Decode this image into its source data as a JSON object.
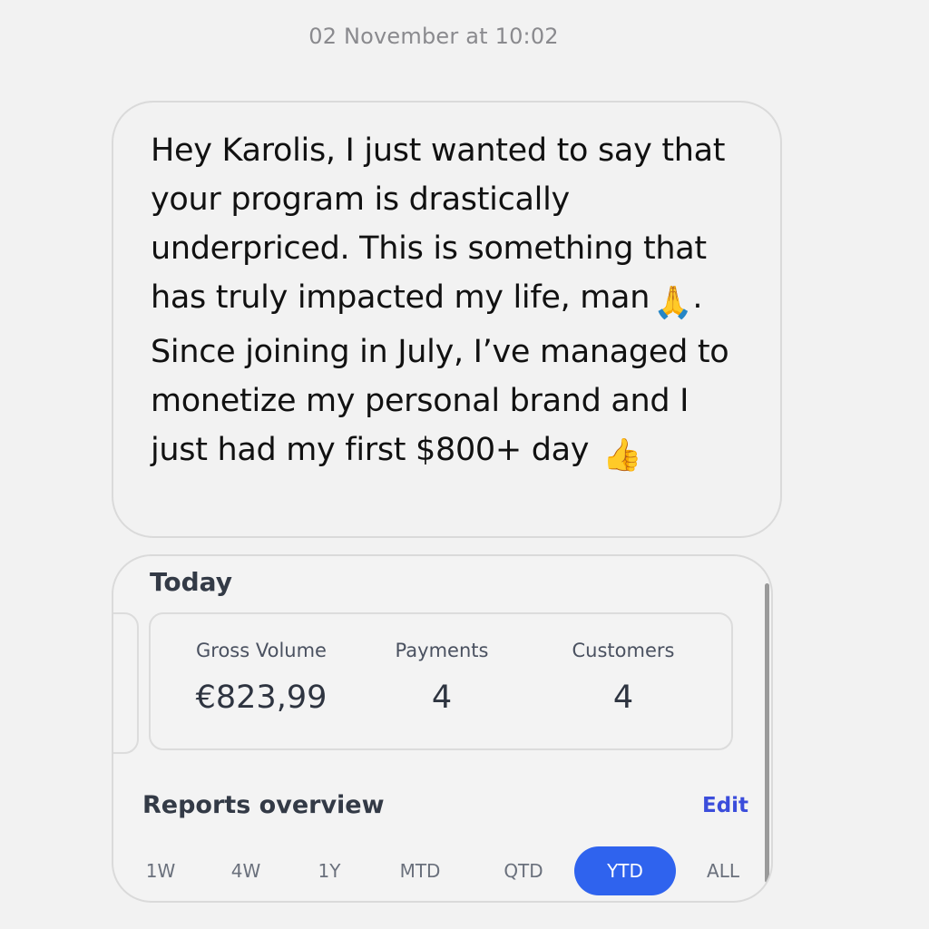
{
  "timestamp": "02 November at 10:02",
  "message": {
    "part1": "Hey Karolis, I just wanted to say that your program is drastically underpriced. This is something that has truly impacted my life, man",
    "emoji1": "🙏",
    "part2": ". Since joining in July, I’ve managed to monetize my personal brand and I just had my first $800+ day",
    "emoji2": "👍"
  },
  "dashboard": {
    "today_title": "Today",
    "stats": [
      {
        "label": "Gross Volume",
        "value": "€823,99"
      },
      {
        "label": "Payments",
        "value": "4"
      },
      {
        "label": "Customers",
        "value": "4"
      }
    ],
    "reports_title": "Reports overview",
    "edit_label": "Edit",
    "ranges": [
      "1W",
      "4W",
      "1Y",
      "MTD",
      "QTD",
      "YTD",
      "ALL"
    ],
    "selected_range": "YTD"
  },
  "colors": {
    "accent": "#2f63ee",
    "edit_link": "#3b4ddb",
    "background": "#f2f2f2"
  }
}
